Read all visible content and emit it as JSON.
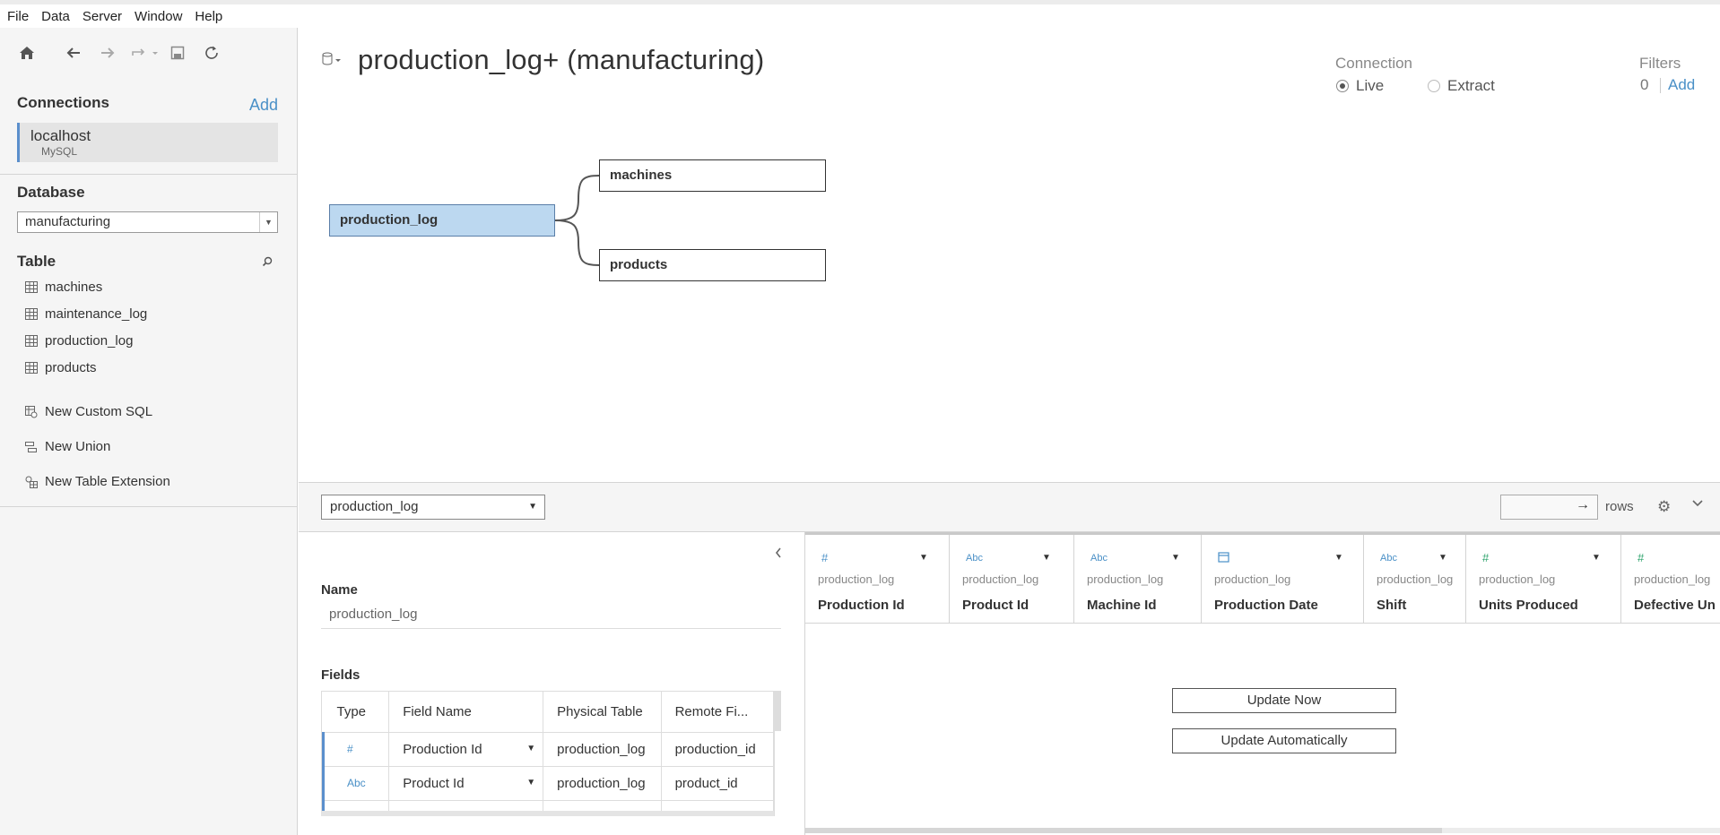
{
  "menu": [
    "File",
    "Data",
    "Server",
    "Window",
    "Help"
  ],
  "connections": {
    "title": "Connections",
    "add_label": "Add",
    "item": {
      "host": "localhost",
      "type": "MySQL"
    }
  },
  "database": {
    "title": "Database",
    "selected": "manufacturing"
  },
  "tables": {
    "title": "Table",
    "items": [
      "machines",
      "maintenance_log",
      "production_log",
      "products"
    ]
  },
  "actions": [
    "New Custom SQL",
    "New Union",
    "New Table Extension"
  ],
  "datasource": {
    "title": "production_log+ (manufacturing)"
  },
  "connection_mode": {
    "label": "Connection",
    "live": "Live",
    "extract": "Extract",
    "selected": "Live"
  },
  "filters": {
    "label": "Filters",
    "count": "0",
    "add_label": "Add"
  },
  "canvas": {
    "main_table": "production_log",
    "joined": [
      "machines",
      "products"
    ]
  },
  "bottom": {
    "table_select": "production_log",
    "rows_label": "rows",
    "name_label": "Name",
    "name_value": "production_log",
    "fields_label": "Fields",
    "fields_headers": [
      "Type",
      "Field Name",
      "Physical Table",
      "Remote Fi..."
    ],
    "fields_rows": [
      {
        "type": "#",
        "name": "Production Id",
        "table": "production_log",
        "remote": "production_id"
      },
      {
        "type": "Abc",
        "name": "Product Id",
        "table": "production_log",
        "remote": "product_id"
      }
    ]
  },
  "preview": {
    "columns": [
      {
        "type": "#",
        "type_color": "blue",
        "source": "production_log",
        "name": "Production Id"
      },
      {
        "type": "Abc",
        "type_color": "blue",
        "source": "production_log",
        "name": "Product Id"
      },
      {
        "type": "Abc",
        "type_color": "blue",
        "source": "production_log",
        "name": "Machine Id"
      },
      {
        "type": "calendar-icon",
        "type_color": "blue",
        "source": "production_log",
        "name": "Production Date"
      },
      {
        "type": "Abc",
        "type_color": "blue",
        "source": "production_log",
        "name": "Shift"
      },
      {
        "type": "#",
        "type_color": "green",
        "source": "production_log",
        "name": "Units Produced"
      },
      {
        "type": "#",
        "type_color": "green",
        "source": "production_log",
        "name": "Defective Un"
      }
    ],
    "update_now": "Update Now",
    "update_auto": "Update Automatically"
  }
}
